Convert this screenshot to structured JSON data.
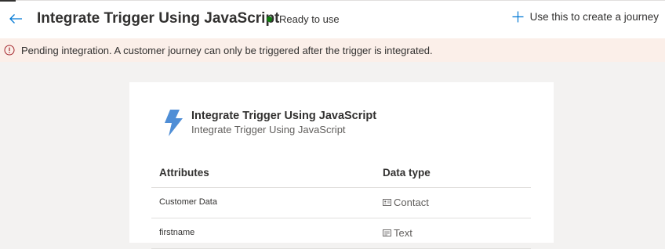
{
  "header": {
    "back_icon": "back-arrow-icon",
    "title": "Integrate Trigger Using JavaScript",
    "status": {
      "label": "Ready to use",
      "color": "#107c10"
    },
    "create_action": {
      "label": "Use this to create a journey",
      "icon": "plus-icon"
    }
  },
  "banner": {
    "icon": "info-icon",
    "text": "Pending integration. A customer journey can only be triggered after the trigger is integrated.",
    "background": "#fbefe9"
  },
  "card": {
    "icon": "lightning-icon",
    "title": "Integrate Trigger Using JavaScript",
    "subtitle": "Integrate Trigger Using JavaScript",
    "table": {
      "columns": [
        "Attributes",
        "Data type"
      ],
      "rows": [
        {
          "attribute": "Customer Data",
          "type": "Contact",
          "type_icon": "contact-card-icon"
        },
        {
          "attribute": "firstname",
          "type": "Text",
          "type_icon": "text-field-icon"
        }
      ]
    }
  },
  "colors": {
    "accent": "#0078d4",
    "icon_blue": "#4f8ed6",
    "status_green": "#107c10"
  }
}
